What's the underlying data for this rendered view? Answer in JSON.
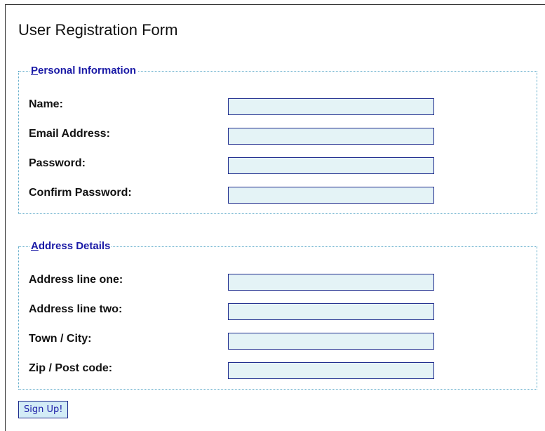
{
  "form": {
    "title": "User Registration Form",
    "personal": {
      "legend_accesskey": "P",
      "legend_rest": "ersonal Information",
      "fields": [
        {
          "label": "Name:",
          "value": ""
        },
        {
          "label": "Email Address:",
          "value": ""
        },
        {
          "label": "Password:",
          "value": ""
        },
        {
          "label": "Confirm Password:",
          "value": ""
        }
      ]
    },
    "address": {
      "legend_accesskey": "A",
      "legend_rest": "ddress Details",
      "fields": [
        {
          "label": "Address line one:",
          "value": ""
        },
        {
          "label": "Address line two:",
          "value": ""
        },
        {
          "label": "Town / City:",
          "value": ""
        },
        {
          "label": "Zip / Post code:",
          "value": ""
        }
      ]
    },
    "submit_label": "Sign Up!"
  }
}
